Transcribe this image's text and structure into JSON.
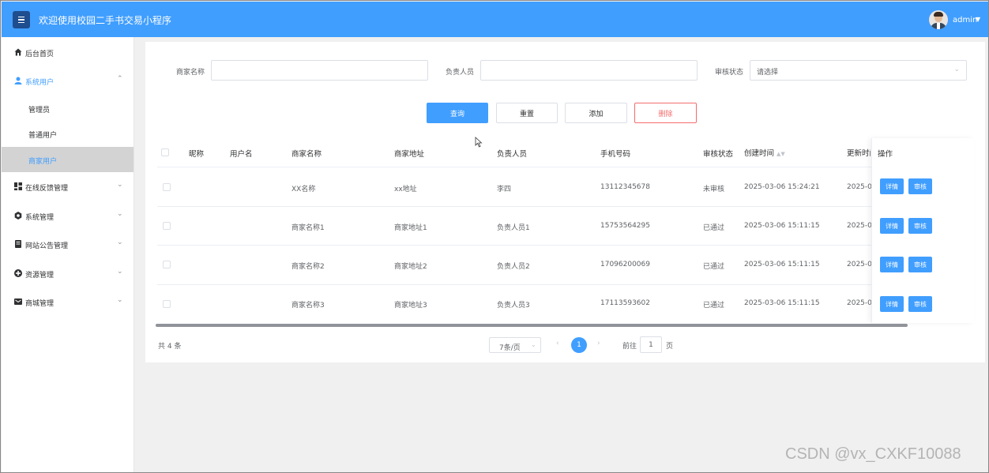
{
  "header": {
    "title": "欢迎使用校园二手书交易小程序",
    "user": "admin"
  },
  "sidebar": {
    "items": [
      {
        "label": "后台首页",
        "icon": "home-icon"
      },
      {
        "label": "系统用户",
        "icon": "user-icon",
        "expanded": true
      },
      {
        "label": "在线反馈管理",
        "icon": "grid-icon"
      },
      {
        "label": "系统管理",
        "icon": "gear-icon"
      },
      {
        "label": "网站公告管理",
        "icon": "notice-icon"
      },
      {
        "label": "资源管理",
        "icon": "plus-circle-icon"
      },
      {
        "label": "商城管理",
        "icon": "mail-icon"
      }
    ],
    "subitems": [
      {
        "label": "管理员"
      },
      {
        "label": "普通用户"
      },
      {
        "label": "商家用户",
        "selected": true
      }
    ]
  },
  "filters": {
    "merchant_name_label": "商家名称",
    "manager_label": "负责人员",
    "audit_status_label": "审核状态",
    "audit_status_placeholder": "请选择"
  },
  "actions": {
    "query": "查询",
    "reset": "重置",
    "add": "添加",
    "delete": "删除"
  },
  "table": {
    "headers": {
      "nickname": "昵称",
      "username": "用户名",
      "merchant_name": "商家名称",
      "merchant_address": "商家地址",
      "manager": "负责人员",
      "phone": "手机号码",
      "audit_status": "审核状态",
      "created_time": "创建时间",
      "updated_time": "更新时间",
      "operations": "操作"
    },
    "rows": [
      {
        "merchant_name": "XX名称",
        "merchant_address": "xx地址",
        "manager": "李四",
        "phone": "13112345678",
        "audit_status": "未审核",
        "created_time": "2025-03-06 15:24:21",
        "updated_time": "2025-0"
      },
      {
        "merchant_name": "商家名称1",
        "merchant_address": "商家地址1",
        "manager": "负责人员1",
        "phone": "15753564295",
        "audit_status": "已通过",
        "created_time": "2025-03-06 15:11:15",
        "updated_time": "2025-0"
      },
      {
        "merchant_name": "商家名称2",
        "merchant_address": "商家地址2",
        "manager": "负责人员2",
        "phone": "17096200069",
        "audit_status": "已通过",
        "created_time": "2025-03-06 15:11:15",
        "updated_time": "2025-0"
      },
      {
        "merchant_name": "商家名称3",
        "merchant_address": "商家地址3",
        "manager": "负责人员3",
        "phone": "17113593602",
        "audit_status": "已通过",
        "created_time": "2025-03-06 15:11:15",
        "updated_time": "2025-0"
      }
    ],
    "detail_label": "详情",
    "audit_label": "审核"
  },
  "pagination": {
    "total": "共 4 条",
    "page_size": "7条/页",
    "current_page": "1",
    "goto_label": "前往",
    "goto_value": "1",
    "goto_unit": "页"
  },
  "watermark": "CSDN @vx_CXKF10088",
  "colors": {
    "primary": "#409eff",
    "danger": "#f56c6c"
  }
}
